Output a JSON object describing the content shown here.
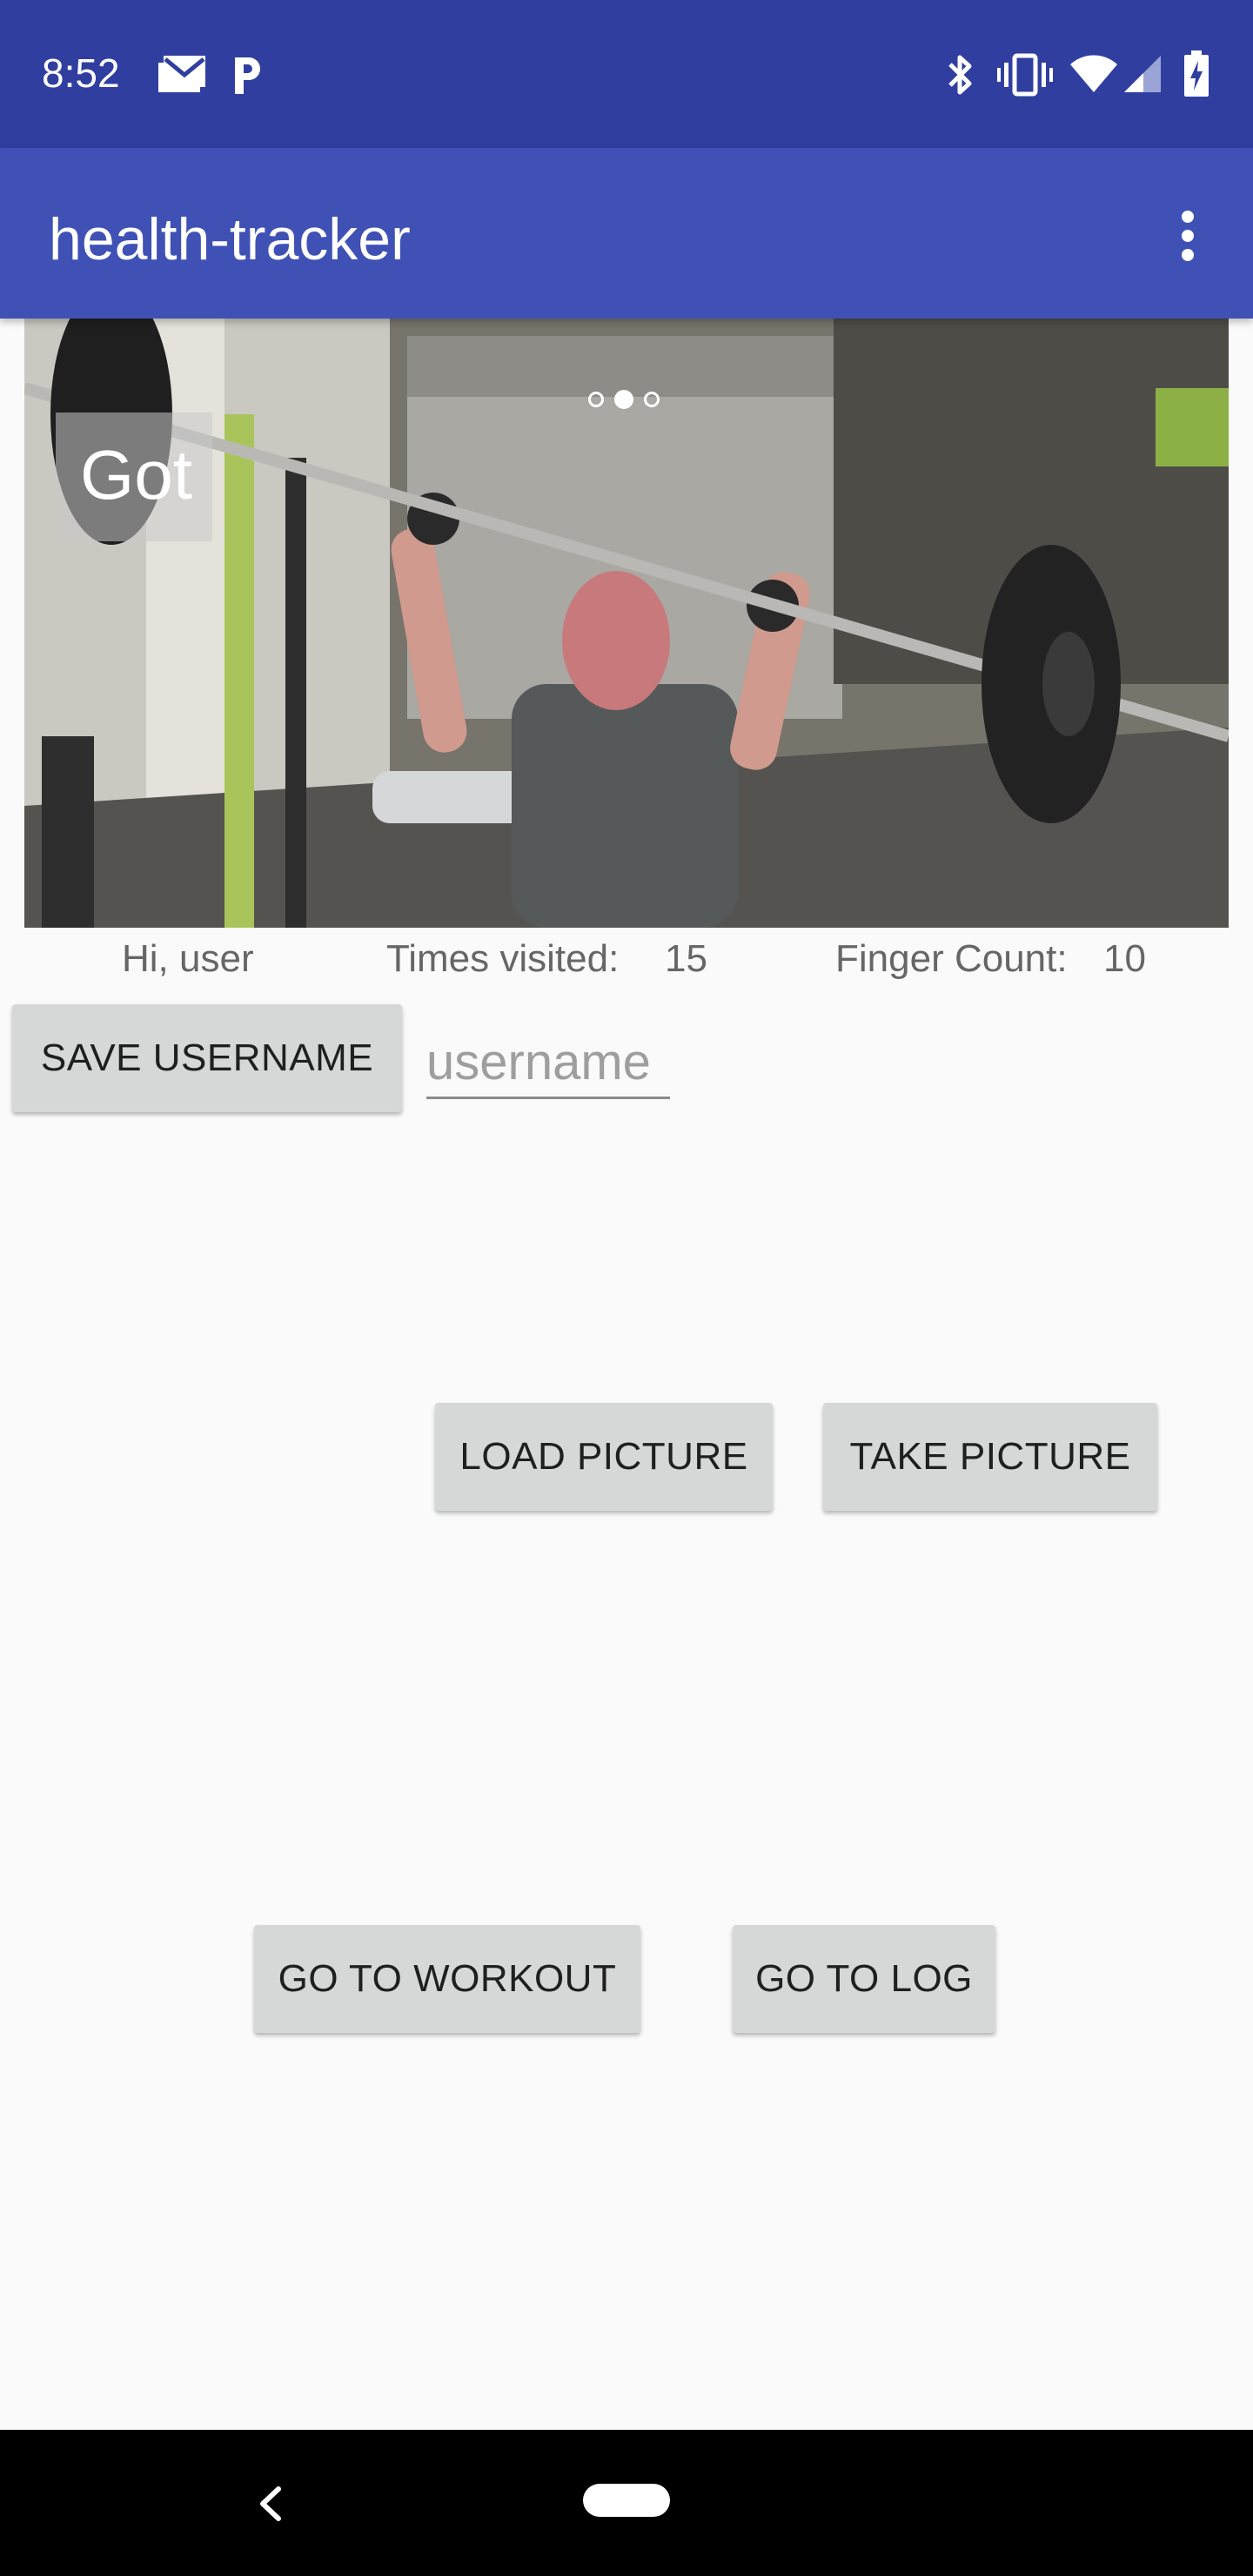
{
  "status_bar": {
    "time": "8:52",
    "icons": [
      "gmail-icon",
      "parking-icon",
      "bluetooth-icon",
      "vibrate-icon",
      "wifi-icon",
      "signal-icon",
      "battery-charging-icon"
    ]
  },
  "app_bar": {
    "title": "health-tracker",
    "menu_icon": "overflow-menu-icon"
  },
  "hero": {
    "caption": "Got",
    "carousel_page_count": 3,
    "carousel_active_index": 1
  },
  "stats": {
    "greeting": "Hi, user",
    "times_visited_label": "Times visited:",
    "times_visited_value": "15",
    "finger_count_label": "Finger Count:",
    "finger_count_value": "10"
  },
  "username": {
    "save_label": "SAVE USERNAME",
    "placeholder": "username",
    "value": ""
  },
  "picture_actions": {
    "load_label": "LOAD PICTURE",
    "take_label": "TAKE PICTURE"
  },
  "navigation": {
    "workout_label": "GO TO WORKOUT",
    "log_label": "GO TO LOG"
  },
  "colors": {
    "status_bar": "#303f9f",
    "app_bar": "#3f51b5",
    "background": "#fafafa",
    "button": "#d6d7d7"
  }
}
